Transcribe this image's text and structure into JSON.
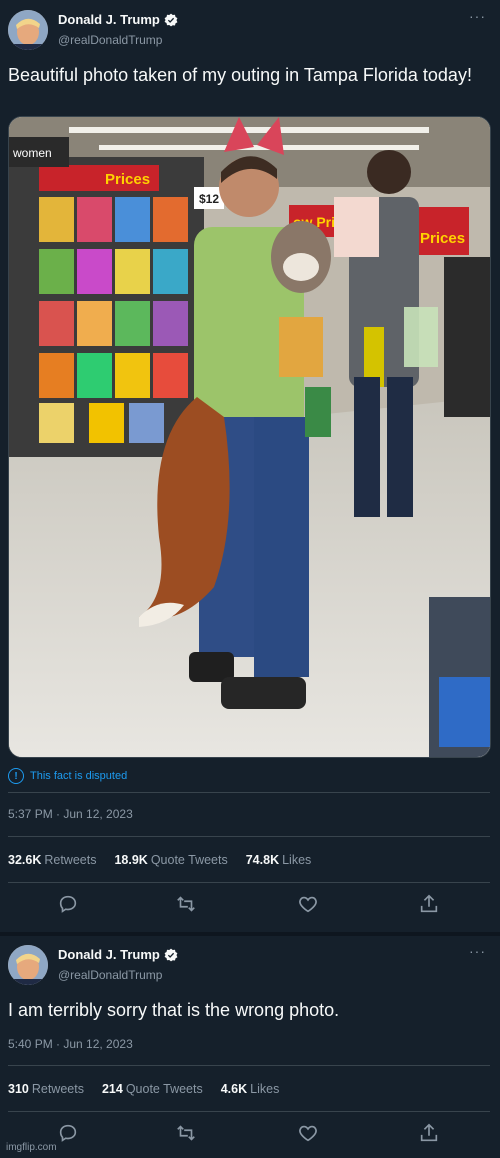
{
  "tweet1": {
    "name": "Donald J. Trump",
    "handle": "@realDonaldTrump",
    "more_icon": "more-icon",
    "text": "Beautiful photo taken of my outing in Tampa Florida today!",
    "photo_signs": {
      "prices": "Prices",
      "low_prices_left": "ow Pric",
      "low_prices_right": "ow Prices",
      "women": "women",
      "price_tag": "$12"
    },
    "disputed": "This fact is disputed",
    "timestamp": "5:37 PM · Jun 12, 2023",
    "stats": {
      "retweets_count": "32.6K",
      "retweets_label": "Retweets",
      "quotes_count": "18.9K",
      "quotes_label": "Quote Tweets",
      "likes_count": "74.8K",
      "likes_label": "Likes"
    }
  },
  "tweet2": {
    "name": "Donald J. Trump",
    "handle": "@realDonaldTrump",
    "text": "I am terribly sorry that is the wrong photo.",
    "timestamp": "5:40 PM · Jun 12, 2023",
    "stats": {
      "retweets_count": "310",
      "retweets_label": "Retweets",
      "quotes_count": "214",
      "quotes_label": "Quote Tweets",
      "likes_count": "4.6K",
      "likes_label": "Likes"
    }
  },
  "watermark": "imgflip.com",
  "colors": {
    "background": "#15202b",
    "accent": "#1d9bf0",
    "muted": "#8b98a5",
    "divider": "#38444d"
  }
}
